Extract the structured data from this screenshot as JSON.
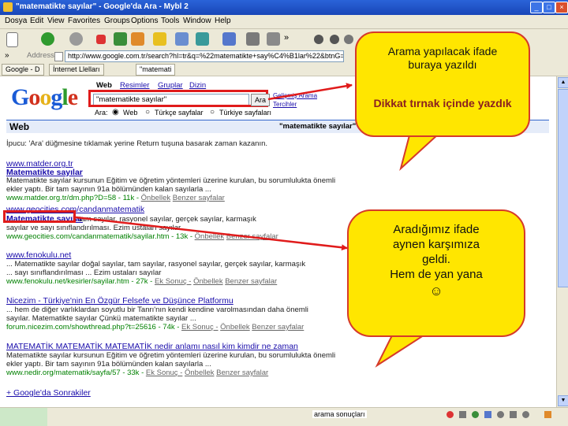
{
  "window": {
    "title": "\"matematikte sayılar\" - Google'da Ara - Mybl 2",
    "controls": [
      "_",
      "□",
      "×"
    ]
  },
  "menu": [
    "Dosya",
    "Edit",
    "View",
    "Favorites",
    "Groups",
    "Options",
    "Tools",
    "Window",
    "Help"
  ],
  "address": {
    "label": "Address",
    "url": "http://www.google.com.tr/search?hl=tr&q=%22matematikte+say%C4%B1lar%22&btnG=Ara&meta="
  },
  "tabs": [
    "Google - D",
    "İnternet Llelları",
    "\"matemati"
  ],
  "google": {
    "logo": "Google",
    "nav": [
      "Web",
      "Resimler",
      "Gruplar",
      "Dizin"
    ],
    "query": "\"matematikte sayılar\"",
    "search_button": "Ara",
    "advanced": "Gelişmiş Arama",
    "prefs": "Tercihler",
    "search_label": "Ara:",
    "options": [
      "Web",
      "Türkçe sayfalar",
      "Türkiye sayfaları"
    ],
    "web_label": "Web",
    "results_for": "\"matematikte sayılar\"",
    "tip": "İpucu: 'Ara' düğmesine tıklamak yerine Return tuşuna basarak zaman kazanın."
  },
  "results": [
    {
      "title": "Matematikte sayılar",
      "url_domain": "www.matder.org.tr",
      "snippet1": "Matematikte sayılar kursunun Eğitim ve öğretim yöntemleri üzerine kurulan, bu sorumlulukta önemli",
      "snippet2": "ekler yaptı. Bir tam sayının 91a bölümünden kalan sayılarla ...",
      "url_line": "www.matder.org.tr/dm.php?D=58 - 11k -",
      "cache": "Önbellek",
      "similar": "Benzer sayfalar"
    },
    {
      "domain_line": "www.geocities.com/candanmatematik",
      "title": "Matematikte sayılar",
      "snippet1": "tam sayılar, rasyonel sayılar, gerçek sayılar, karmaşık",
      "snippet2": "sayılar ve sayı sınıflandırılması. Ezim ustaları sayılar",
      "url_line": "www.geocities.com/candanmatematik/sayilar.htm - 13k -",
      "cache": "Önbellek",
      "similar": "Benzer sayfalar"
    },
    {
      "domain_line": "www.fenokulu.net",
      "snippet1": "... Matematikte sayılar doğal sayılar, tam sayılar, rasyonel sayılar, gerçek sayılar, karmaşık",
      "snippet2": "... sayı sınıflandırılması ... Ezim ustaları sayılar",
      "url_line": "www.fenokulu.net/kesirler/sayilar.htm - 27k -",
      "extra": "Ek Sonuç -",
      "cache": "Önbellek",
      "similar": "Benzer sayfalar"
    },
    {
      "title": "Nicezim - Türkiye'nin En Özgür Felsefe ve Düşünce Platformu",
      "snippet1": "... hem de diğer varlıklardan soyutlu bir Tanrı'nın kendi kendine varolmasından daha önemli",
      "snippet2": "sayılar. Matematikte sayılar Çünkü matematikte sayılar ...",
      "url_line": "forum.nicezim.com/showthread.php?t=25616 - 74k -",
      "extra": "Ek Sonuç -",
      "cache": "Önbellek",
      "similar": "Benzer sayfalar"
    },
    {
      "title": "MATEMATİK MATEMATİK MATEMATİK nedir anlamı nasıl kim kimdir ne zaman",
      "snippet1": "Matematikte sayılar kursunun Eğitim ve öğretim yöntemleri üzerine kurulan, bu sorumlulukta önemli",
      "snippet2": "ekler yaptı. Bir tam sayının 91a bölümünden kalan sayılarla ...",
      "url_line": "www.nedir.org/matematik/sayfa/57 - 33k -",
      "extra": "Ek Sonuç -",
      "cache": "Önbellek",
      "similar": "Benzer sayfalar"
    }
  ],
  "more_link": "+ Google'da Sonrakiler",
  "status": {
    "text": "arama sonuçları"
  },
  "callouts": {
    "top1": "Arama yapılacak ifade buraya yazıldı",
    "top2": "Dikkat tırnak içinde yazdık",
    "bottom1": "Aradığımız ifade",
    "bottom2": "aynen karşımıza",
    "bottom3": "geldi.",
    "bottom4": "Hem de yan yana",
    "smiley": "☺"
  },
  "colors": {
    "callout_fill": "#ffe600",
    "callout_border": "#d63a2a",
    "highlight_red": "#e01b1b",
    "xp_blue": "#2a63d8"
  }
}
